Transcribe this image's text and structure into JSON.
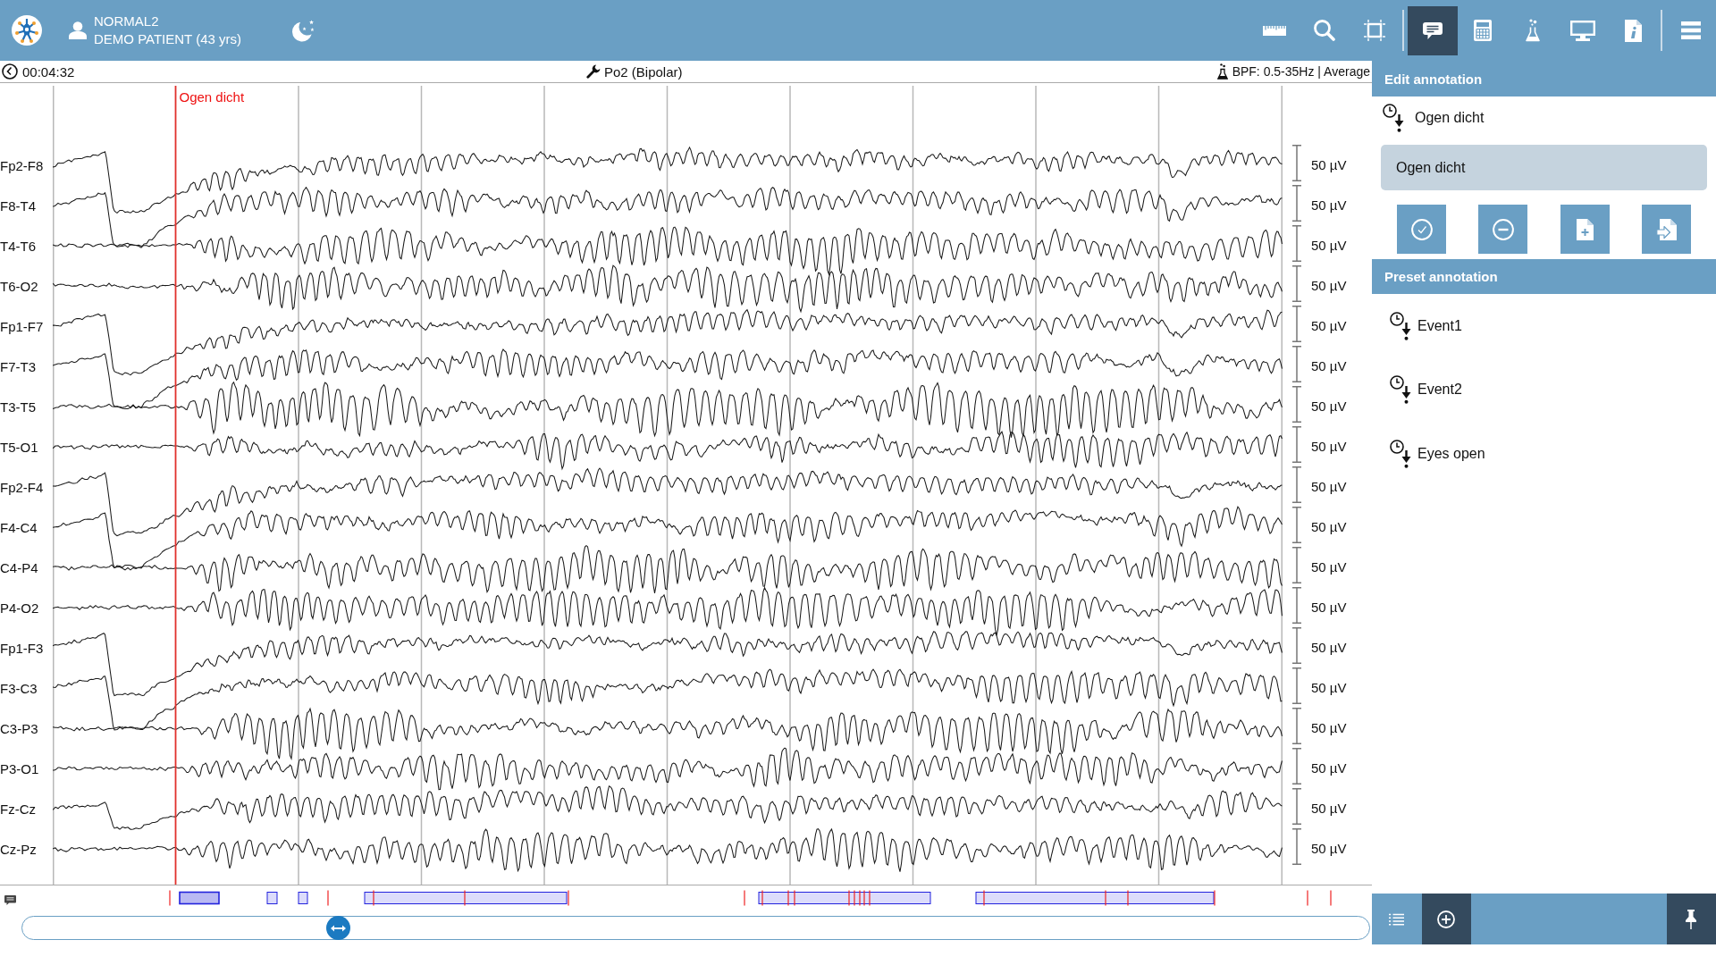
{
  "top_bar": {
    "patient_name": "NORMAL2",
    "patient_details": "DEMO PATIENT (43 yrs)",
    "tool_groups": [
      [
        {
          "kind": "ruler",
          "selected": false
        },
        {
          "kind": "search",
          "selected": false
        },
        {
          "kind": "crop",
          "selected": false
        }
      ],
      [
        {
          "kind": "annotation",
          "selected": true
        },
        {
          "kind": "calculator",
          "selected": false
        },
        {
          "kind": "flask",
          "selected": false
        },
        {
          "kind": "monitor",
          "selected": false
        },
        {
          "kind": "info",
          "selected": false
        }
      ],
      [
        {
          "kind": "menu",
          "selected": false
        }
      ]
    ]
  },
  "info_bar": {
    "time": "00:04:32",
    "montage": "Po2 (Bipolar)",
    "filter": "BPF: 0.5-35Hz | Average"
  },
  "eeg": {
    "markers": [
      {
        "label": "Ogen dicht"
      }
    ],
    "channels": [
      {
        "label": "Fp2-F8",
        "scale": "50 µV"
      },
      {
        "label": "F8-T4",
        "scale": "50 µV"
      },
      {
        "label": "T4-T6",
        "scale": "50 µV"
      },
      {
        "label": "T6-O2",
        "scale": "50 µV"
      },
      {
        "label": "Fp1-F7",
        "scale": "50 µV"
      },
      {
        "label": "F7-T3",
        "scale": "50 µV"
      },
      {
        "label": "T3-T5",
        "scale": "50 µV"
      },
      {
        "label": "T5-O1",
        "scale": "50 µV"
      },
      {
        "label": "Fp2-F4",
        "scale": "50 µV"
      },
      {
        "label": "F4-C4",
        "scale": "50 µV"
      },
      {
        "label": "C4-P4",
        "scale": "50 µV"
      },
      {
        "label": "P4-O2",
        "scale": "50 µV"
      },
      {
        "label": "Fp1-F3",
        "scale": "50 µV"
      },
      {
        "label": "F3-C3",
        "scale": "50 µV"
      },
      {
        "label": "C3-P3",
        "scale": "50 µV"
      },
      {
        "label": "P3-O1",
        "scale": "50 µV"
      },
      {
        "label": "Fz-Cz",
        "scale": "50 µV"
      },
      {
        "label": "Cz-Pz",
        "scale": "50 µV"
      }
    ]
  },
  "timeline": {
    "level": 0.23
  },
  "edit_annotation": {
    "title": "Edit annotation",
    "annotation": "Ogen dicht",
    "input_value": "Ogen dicht",
    "buttons": [
      {
        "kind": "confirm"
      },
      {
        "kind": "delete"
      },
      {
        "kind": "new"
      },
      {
        "kind": "import"
      }
    ]
  },
  "preset_annotation": {
    "title": "Preset annotation",
    "items": [
      {
        "label": "Event1"
      },
      {
        "label": "Event2"
      },
      {
        "label": "Eyes open"
      }
    ]
  },
  "panel_toolbar": [
    {
      "kind": "list",
      "selected": false
    },
    {
      "kind": "add",
      "selected": true
    },
    {
      "kind": "pin",
      "selected": true
    }
  ]
}
